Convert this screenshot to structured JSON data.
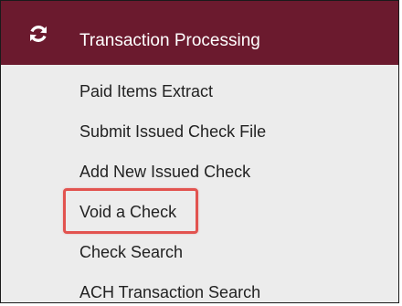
{
  "header": {
    "title": "Transaction Processing",
    "icon": "refresh-icon"
  },
  "menu": {
    "items": [
      {
        "label": "Paid Items Extract"
      },
      {
        "label": "Submit Issued Check File"
      },
      {
        "label": "Add New Issued Check"
      },
      {
        "label": "Void a Check",
        "highlighted": true
      },
      {
        "label": "Check Search"
      },
      {
        "label": "ACH Transaction Search"
      }
    ]
  },
  "colors": {
    "header_bg": "#6b1a2e",
    "panel_bg": "#ececec",
    "highlight_border": "#e2534f"
  }
}
